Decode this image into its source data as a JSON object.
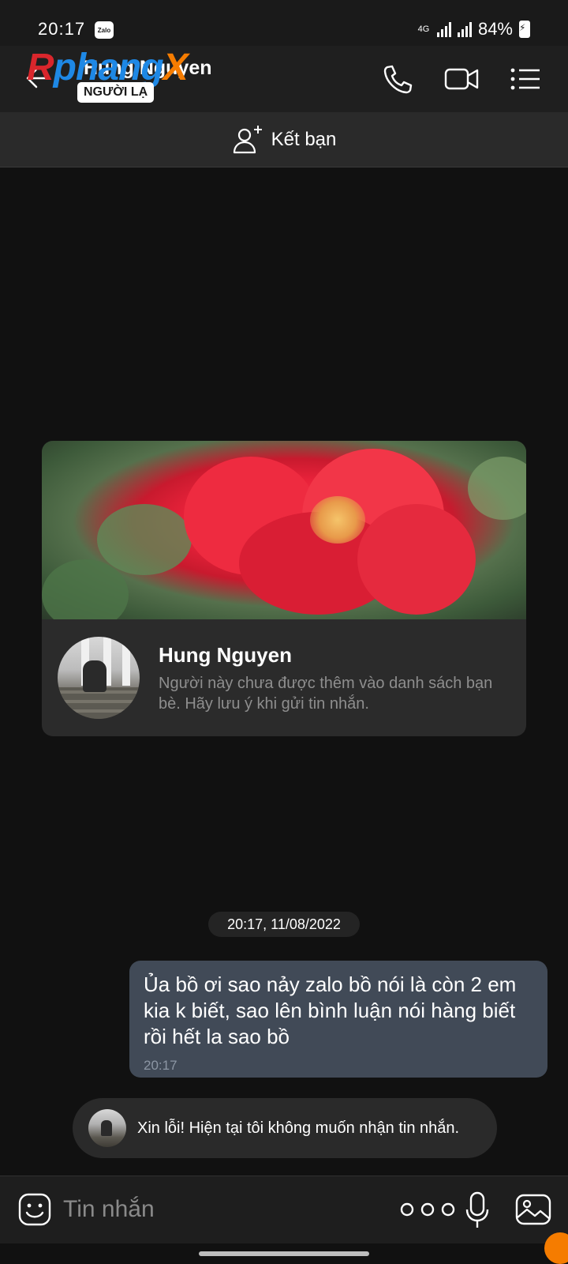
{
  "status_bar": {
    "time": "20:17",
    "app_badge": "Zalo",
    "network": "4G",
    "battery": "84%"
  },
  "watermark": {
    "part_a": "R",
    "part_b": "phang",
    "part_c": "X"
  },
  "header": {
    "contact_name": "Hung Nguyen",
    "stranger_tag": "NGƯỜI LẠ",
    "icons": [
      "back-arrow-icon",
      "phone-icon",
      "video-call-icon",
      "menu-list-icon"
    ]
  },
  "add_friend": {
    "label": "Kết bạn",
    "icon": "add-person-icon"
  },
  "profile_card": {
    "name": "Hung Nguyen",
    "note": "Người này chưa được thêm vào danh sách bạn bè. Hãy lưu ý khi gửi tin nhắn."
  },
  "messages": {
    "timestamp": "20:17, 11/08/2022",
    "outgoing": {
      "text": "Ủa bồ ơi sao nảy zalo bồ nói là còn 2 em kia k biết, sao lên bình luận nói hàng biết rồi hết la sao bồ",
      "time": "20:17"
    },
    "system_reply": "Xin lỗi! Hiện tại tôi không muốn nhận tin nhắn."
  },
  "input_bar": {
    "placeholder": "Tin nhắn",
    "icons": [
      "emoji-icon",
      "more-icon",
      "microphone-icon",
      "gallery-icon"
    ]
  },
  "colors": {
    "background": "#111111",
    "header": "#1f1f1f",
    "outgoing_bubble": "#414a57",
    "card": "#2b2b2b",
    "muted_text": "#8e8e8e"
  }
}
